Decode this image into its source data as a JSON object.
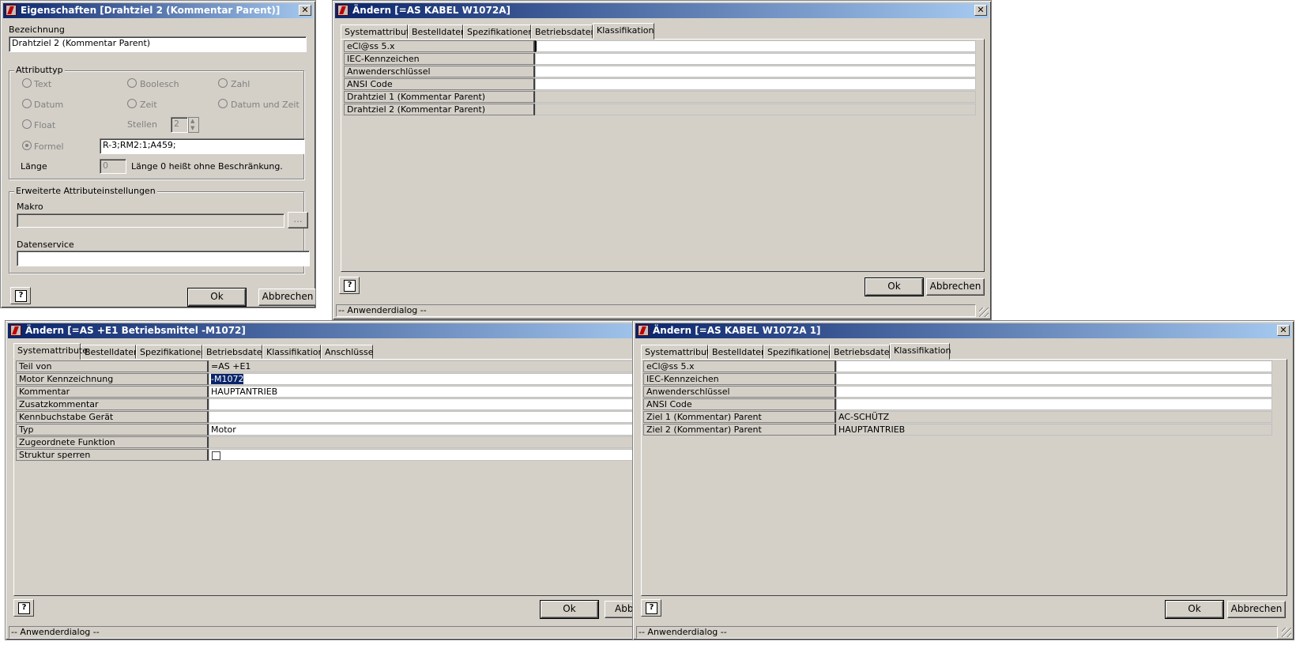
{
  "win1": {
    "title": "Eigenschaften [Drahtziel 2 (Kommentar Parent)]",
    "bezeichnung_label": "Bezeichnung",
    "bezeichnung_value": "Drahtziel 2 (Kommentar Parent)",
    "attributtyp_label": "Attributtyp",
    "radios": {
      "text": "Text",
      "boolesch": "Boolesch",
      "zahl": "Zahl",
      "datum": "Datum",
      "zeit": "Zeit",
      "datum_und_zeit": "Datum und Zeit",
      "float": "Float",
      "stellen": "Stellen",
      "formel": "Formel"
    },
    "stellen_value": "2",
    "formel_value": "R-3;RM2:1;A459;",
    "laenge_label": "Länge",
    "laenge_value": "0",
    "laenge_hint": "Länge 0 heißt ohne Beschränkung.",
    "erweitert_label": "Erweiterte Attributeinstellungen",
    "makro_label": "Makro",
    "makro_browse": "...",
    "datenservice_label": "Datenservice",
    "ok": "Ok",
    "cancel": "Abbrechen",
    "help": "?"
  },
  "win2": {
    "title": "Ändern [=AS KABEL W1072A]",
    "tabs": [
      "Systemattribute",
      "Bestelldaten",
      "Spezifikationen",
      "Betriebsdaten",
      "Klassifikation"
    ],
    "rows": [
      {
        "k": "eCl@ss 5.x",
        "v": ""
      },
      {
        "k": "IEC-Kennzeichen",
        "v": ""
      },
      {
        "k": "Anwenderschlüssel",
        "v": ""
      },
      {
        "k": "ANSI Code",
        "v": ""
      },
      {
        "k": "Drahtziel 1 (Kommentar Parent)",
        "v": ""
      },
      {
        "k": "Drahtziel 2 (Kommentar Parent)",
        "v": ""
      }
    ],
    "ok": "Ok",
    "cancel": "Abbrechen",
    "status": "-- Anwenderdialog --",
    "help": "?"
  },
  "win3": {
    "title": "Ändern [=AS +E1 Betriebsmittel -M1072]",
    "tabs": [
      "Systemattribute",
      "Bestelldaten",
      "Spezifikationen",
      "Betriebsdaten",
      "Klassifikation",
      "Anschlüsse"
    ],
    "rows": [
      {
        "k": "Teil von",
        "v": "=AS +E1"
      },
      {
        "k": "Motor Kennzeichnung",
        "v": "-M1072"
      },
      {
        "k": "Kommentar",
        "v": "HAUPTANTRIEB"
      },
      {
        "k": "Zusatzkommentar",
        "v": ""
      },
      {
        "k": "Kennbuchstabe Gerät",
        "v": ""
      },
      {
        "k": "Typ",
        "v": "Motor"
      },
      {
        "k": "Zugeordnete Funktion",
        "v": ""
      },
      {
        "k": "Struktur sperren",
        "v": ""
      }
    ],
    "ok": "Ok",
    "cancel": "Abbr",
    "status": "-- Anwenderdialog --",
    "help": "?"
  },
  "win4": {
    "title": "Ändern [=AS KABEL W1072A 1]",
    "tabs": [
      "Systemattribute",
      "Bestelldaten",
      "Spezifikationen",
      "Betriebsdaten",
      "Klassifikation"
    ],
    "rows": [
      {
        "k": "eCl@ss 5.x",
        "v": ""
      },
      {
        "k": "IEC-Kennzeichen",
        "v": ""
      },
      {
        "k": "Anwenderschlüssel",
        "v": ""
      },
      {
        "k": "ANSI Code",
        "v": ""
      },
      {
        "k": "Ziel 1 (Kommentar) Parent",
        "v": "AC-SCHÜTZ"
      },
      {
        "k": "Ziel 2 (Kommentar) Parent",
        "v": "HAUPTANTRIEB"
      }
    ],
    "ok": "Ok",
    "cancel": "Abbrechen",
    "status": "-- Anwenderdialog --",
    "help": "?"
  }
}
